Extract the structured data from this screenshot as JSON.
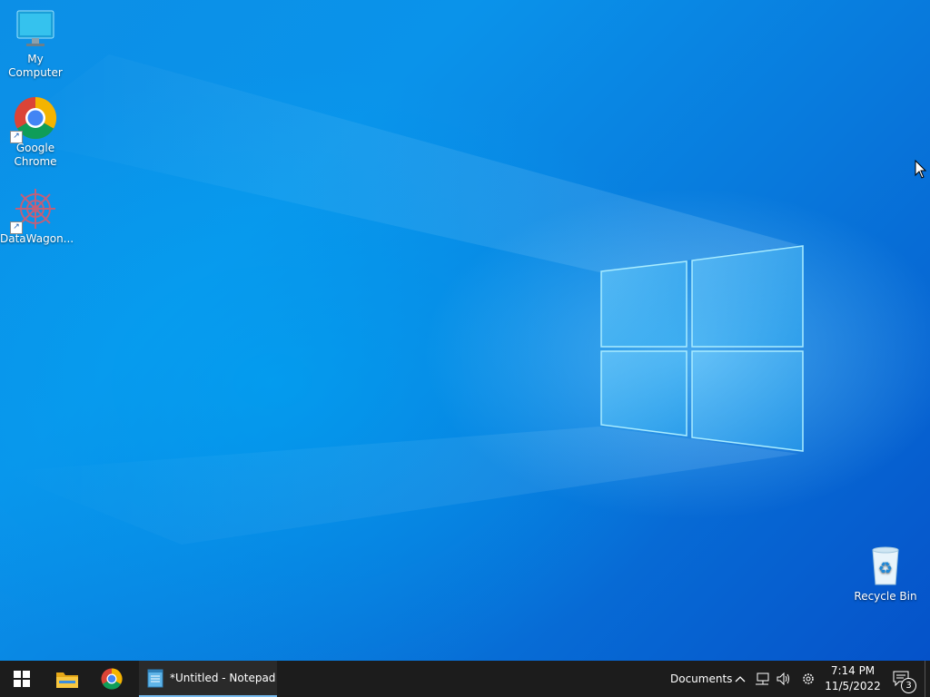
{
  "desktop": {
    "icons": [
      {
        "label": "My Computer",
        "icon": "computer-icon"
      },
      {
        "label": "Google Chrome",
        "icon": "chrome-icon",
        "shortcut": true
      },
      {
        "label": "DataWagon...",
        "icon": "datawagon-icon",
        "shortcut": true
      },
      {
        "label": "Recycle Bin",
        "icon": "recycle-bin-icon"
      }
    ]
  },
  "taskbar": {
    "start_icon": "windows-logo-icon",
    "pinned": [
      {
        "name": "file-explorer",
        "icon": "folder-icon"
      },
      {
        "name": "chrome",
        "icon": "chrome-icon"
      }
    ],
    "active_window": {
      "label": "*Untitled - Notepad",
      "icon": "notepad-icon"
    },
    "toolbar_label": "Documents",
    "tray": {
      "time": "7:14 PM",
      "date": "11/5/2022",
      "notification_count": "3"
    }
  },
  "colors": {
    "taskbar_bg": "#1c1c1c",
    "active_indicator": "#76b9ed",
    "desktop_blue": "#0a78d6"
  }
}
